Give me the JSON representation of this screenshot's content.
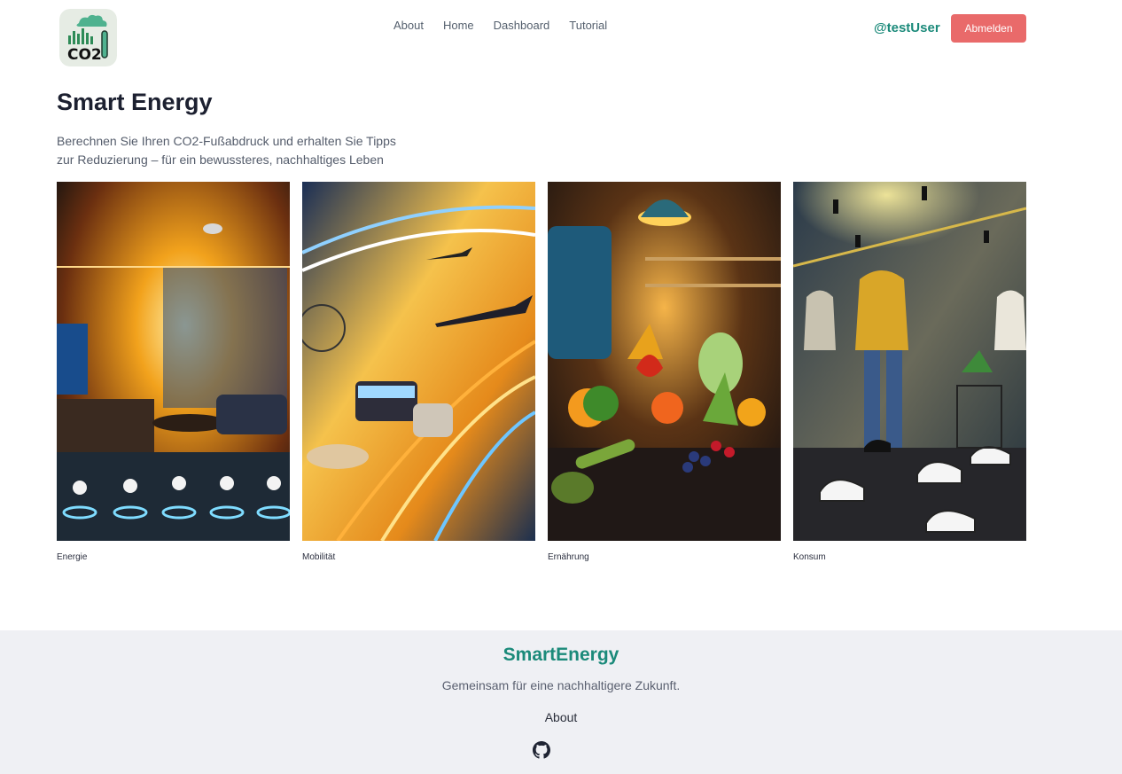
{
  "header": {
    "logo_text": "CO2",
    "nav": [
      {
        "label": "About"
      },
      {
        "label": "Home"
      },
      {
        "label": "Dashboard"
      },
      {
        "label": "Tutorial"
      }
    ],
    "user": "@testUser",
    "logout_label": "Abmelden"
  },
  "hero": {
    "title": "Smart Energy",
    "subtitle_line1": "Berechnen Sie Ihren CO2-Fußabdruck und erhalten Sie Tipps",
    "subtitle_line2": "zur Reduzierung – für ein bewussteres, nachhaltiges Leben"
  },
  "categories": [
    {
      "label": "Energie",
      "image": "smart-home-living-room"
    },
    {
      "label": "Mobilität",
      "image": "transport-airplane-bus-highway"
    },
    {
      "label": "Ernährung",
      "image": "vegetables-fruits-kitchen"
    },
    {
      "label": "Konsum",
      "image": "clothing-store-sneakers"
    }
  ],
  "footer": {
    "brand": "SmartEnergy",
    "tagline": "Gemeinsam für eine nachhaltigere Zukunft.",
    "about_label": "About",
    "github_icon": "github-icon"
  },
  "colors": {
    "accent": "#1b8a7a",
    "logout": "#e96a6a",
    "footer_bg": "#eff0f4"
  }
}
